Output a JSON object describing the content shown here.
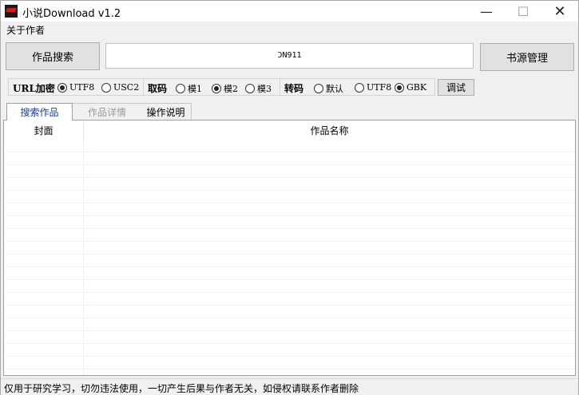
{
  "window": {
    "title": "小说Download v1.2"
  },
  "menu": {
    "about": "关于作者"
  },
  "toolbar": {
    "search_label": "作品搜索",
    "source_label": "书源管理",
    "search_value": "ϽN911"
  },
  "options": {
    "url_label": "URL加密",
    "url_opts": [
      "UTF8",
      "USC2"
    ],
    "url_selected": "UTF8",
    "fetch_label": "取码",
    "fetch_opts": [
      "模1",
      "模2",
      "模3"
    ],
    "fetch_selected": "模2",
    "conv_label": "转码",
    "conv_opts": [
      "默认",
      "UTF8",
      "GBK"
    ],
    "conv_selected": "GBK",
    "debug_label": "调试"
  },
  "tabs": [
    "搜索作品",
    "作品详情",
    "操作说明"
  ],
  "table": {
    "col_cover": "封面",
    "col_name": "作品名称"
  },
  "status": "仅用于研究学习，切勿违法使用，一切产生后果与作者无关，如侵权请联系作者删除"
}
